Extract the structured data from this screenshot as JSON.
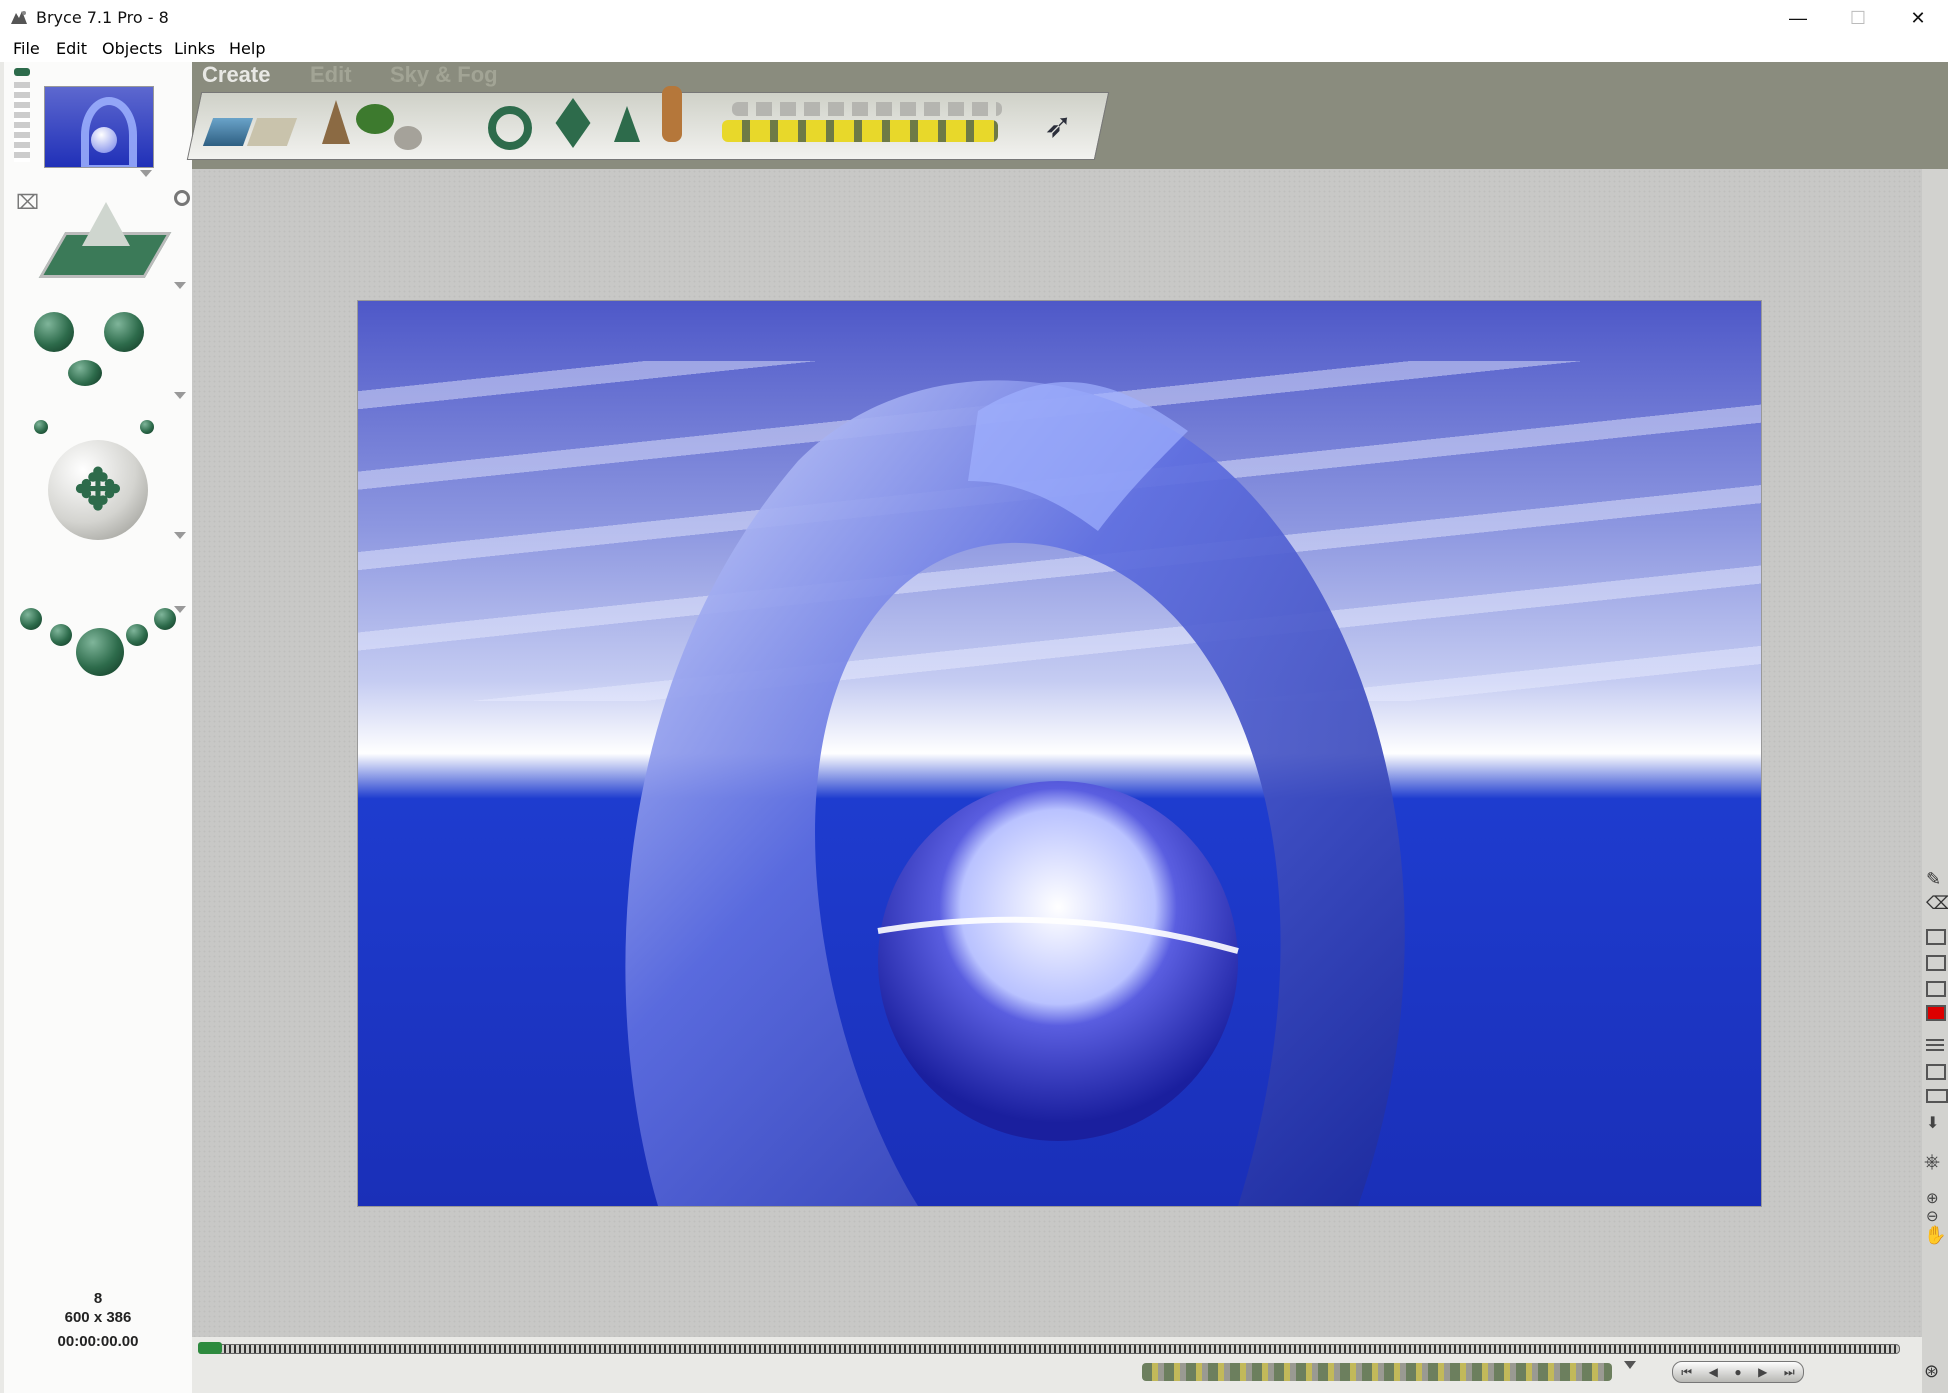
{
  "window": {
    "title": "Bryce 7.1  Pro - 8",
    "minimize": "—",
    "maximize": "☐",
    "close": "✕"
  },
  "menu": {
    "items": [
      "File",
      "Edit",
      "Objects",
      "Links",
      "Help"
    ]
  },
  "tabs": {
    "create": "Create",
    "edit": "Edit",
    "sky_fog": "Sky & Fog"
  },
  "status": {
    "frame": "8",
    "size": "600 x 386",
    "time": "00:00:00.00"
  },
  "colors": {
    "accent": "#2d6b4b",
    "sky_top": "#4a55c8",
    "sea": "#1a2fc0"
  }
}
